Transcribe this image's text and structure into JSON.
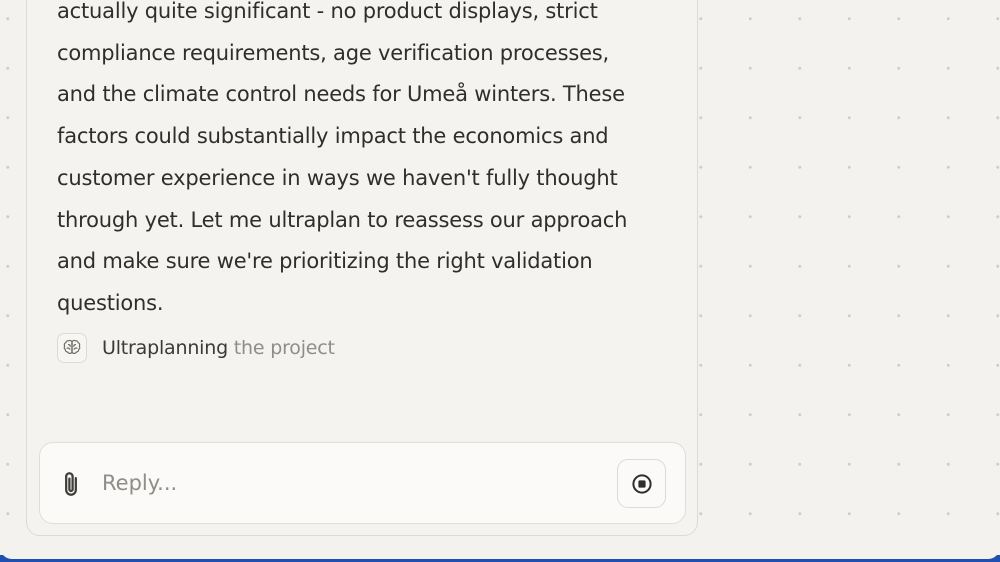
{
  "conversation": {
    "message_text": "actually quite significant - no product displays, strict\ncompliance requirements, age verification processes,\nand the climate control needs for Umeå winters. These\nfactors could substantially impact the economics and\ncustomer experience in ways we haven't fully thought\nthrough yet. Let me ultraplan to reassess our approach\nand make sure we're prioritizing the right validation\nquestions.",
    "status": {
      "icon": "brain-icon",
      "label_strong": "Ultraplanning",
      "label_muted": " the project"
    }
  },
  "composer": {
    "attach_icon": "paperclip-icon",
    "placeholder": "Reply...",
    "value": "",
    "stop_icon": "stop-icon"
  }
}
